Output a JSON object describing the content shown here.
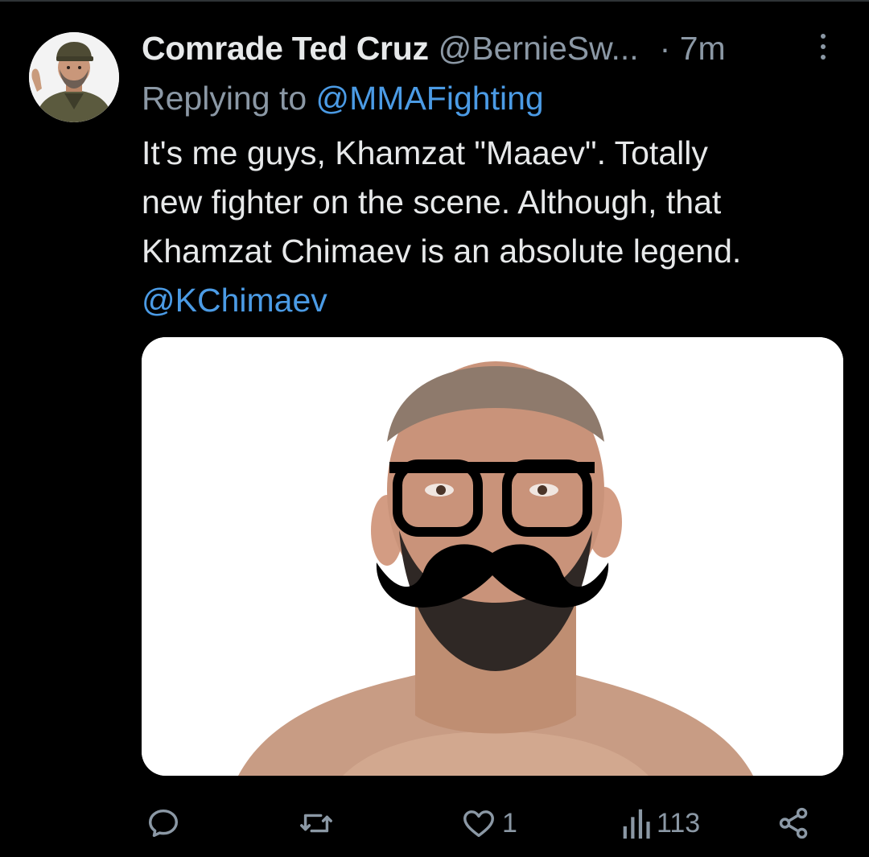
{
  "tweet": {
    "display_name": "Comrade Ted Cruz",
    "handle": "@BernieSw...",
    "time": "· 7m",
    "replying_prefix": "Replying to",
    "replying_handle": "@MMAFighting",
    "text_lines": [
      "It's me guys, Khamzat \"Maaev\". Totally",
      "new fighter on the scene. Although, that",
      "Khamzat Chimaev is an absolute legend."
    ],
    "mention": "@KChimaev"
  },
  "actions": {
    "reply_icon": "reply-icon",
    "retweet_icon": "retweet-icon",
    "like_icon": "heart-icon",
    "like_count": "1",
    "views_icon": "views-icon",
    "views_count": "113",
    "share_icon": "share-icon"
  },
  "colors": {
    "background": "#000000",
    "text": "#e7e9ea",
    "muted": "#8b98a5",
    "link": "#4b9be5"
  }
}
